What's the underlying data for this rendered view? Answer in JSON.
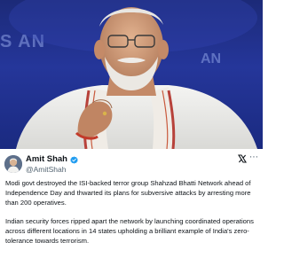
{
  "photo": {
    "background_text_left": "S AN",
    "background_text_right": "AN"
  },
  "tweet": {
    "author_name": "Amit Shah",
    "handle": "@AmitShah",
    "paragraph_1": "Modi govt destroyed the ISI-backed terror group Shahzad Bhatti Network ahead of Independence Day and thwarted its plans for subversive attacks by arresting more than 200 operatives.",
    "paragraph_2": "Indian security forces ripped apart the network by launching coordinated operations across different locations in 14 states upholding a brilliant example of India's zero-tolerance towards terrorism.",
    "icons": {
      "verified": "verified-badge-icon",
      "platform": "x-logo-icon",
      "more": "more-options-icon"
    }
  },
  "colors": {
    "photo_background": "#25369a",
    "verified_badge": "#1d9bf0",
    "text_primary": "#0f1419",
    "text_secondary": "#536471"
  }
}
